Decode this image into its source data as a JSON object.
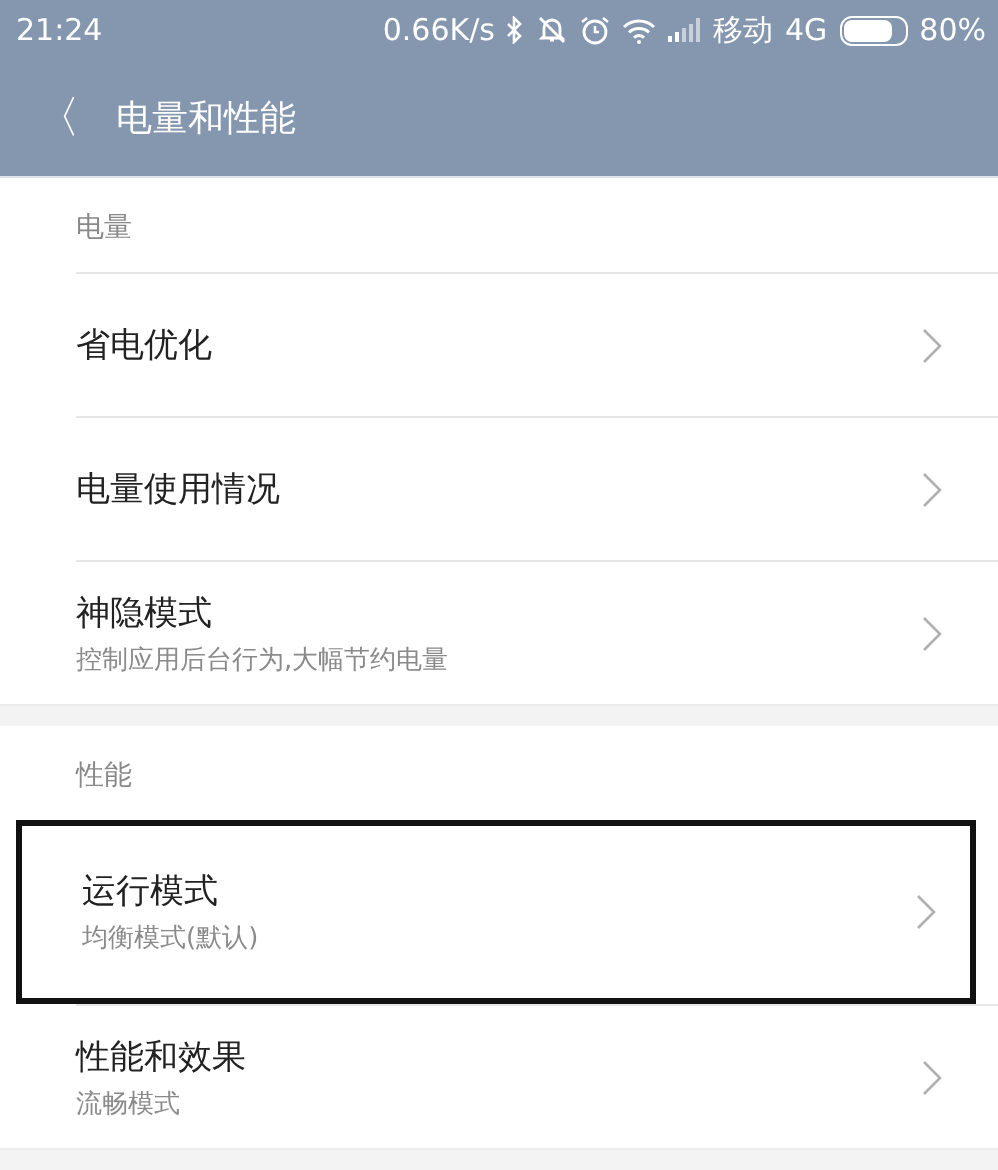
{
  "status_bar": {
    "time": "21:24",
    "speed": "0.66K/s",
    "carrier": "移动",
    "network": "4G",
    "battery": "80%"
  },
  "header": {
    "back": "〈",
    "title": "电量和性能"
  },
  "sections": [
    {
      "title": "电量",
      "items": [
        {
          "title": "省电优化",
          "highlighted": false
        },
        {
          "title": "电量使用情况",
          "highlighted": false
        },
        {
          "title": "神隐模式",
          "subtitle": "控制应用后台行为,大幅节约电量",
          "highlighted": false
        }
      ]
    },
    {
      "title": "性能",
      "items": [
        {
          "title": "运行模式",
          "subtitle": "均衡模式(默认)",
          "highlighted": true
        },
        {
          "title": "性能和效果",
          "subtitle": "流畅模式",
          "highlighted": false
        }
      ]
    }
  ]
}
